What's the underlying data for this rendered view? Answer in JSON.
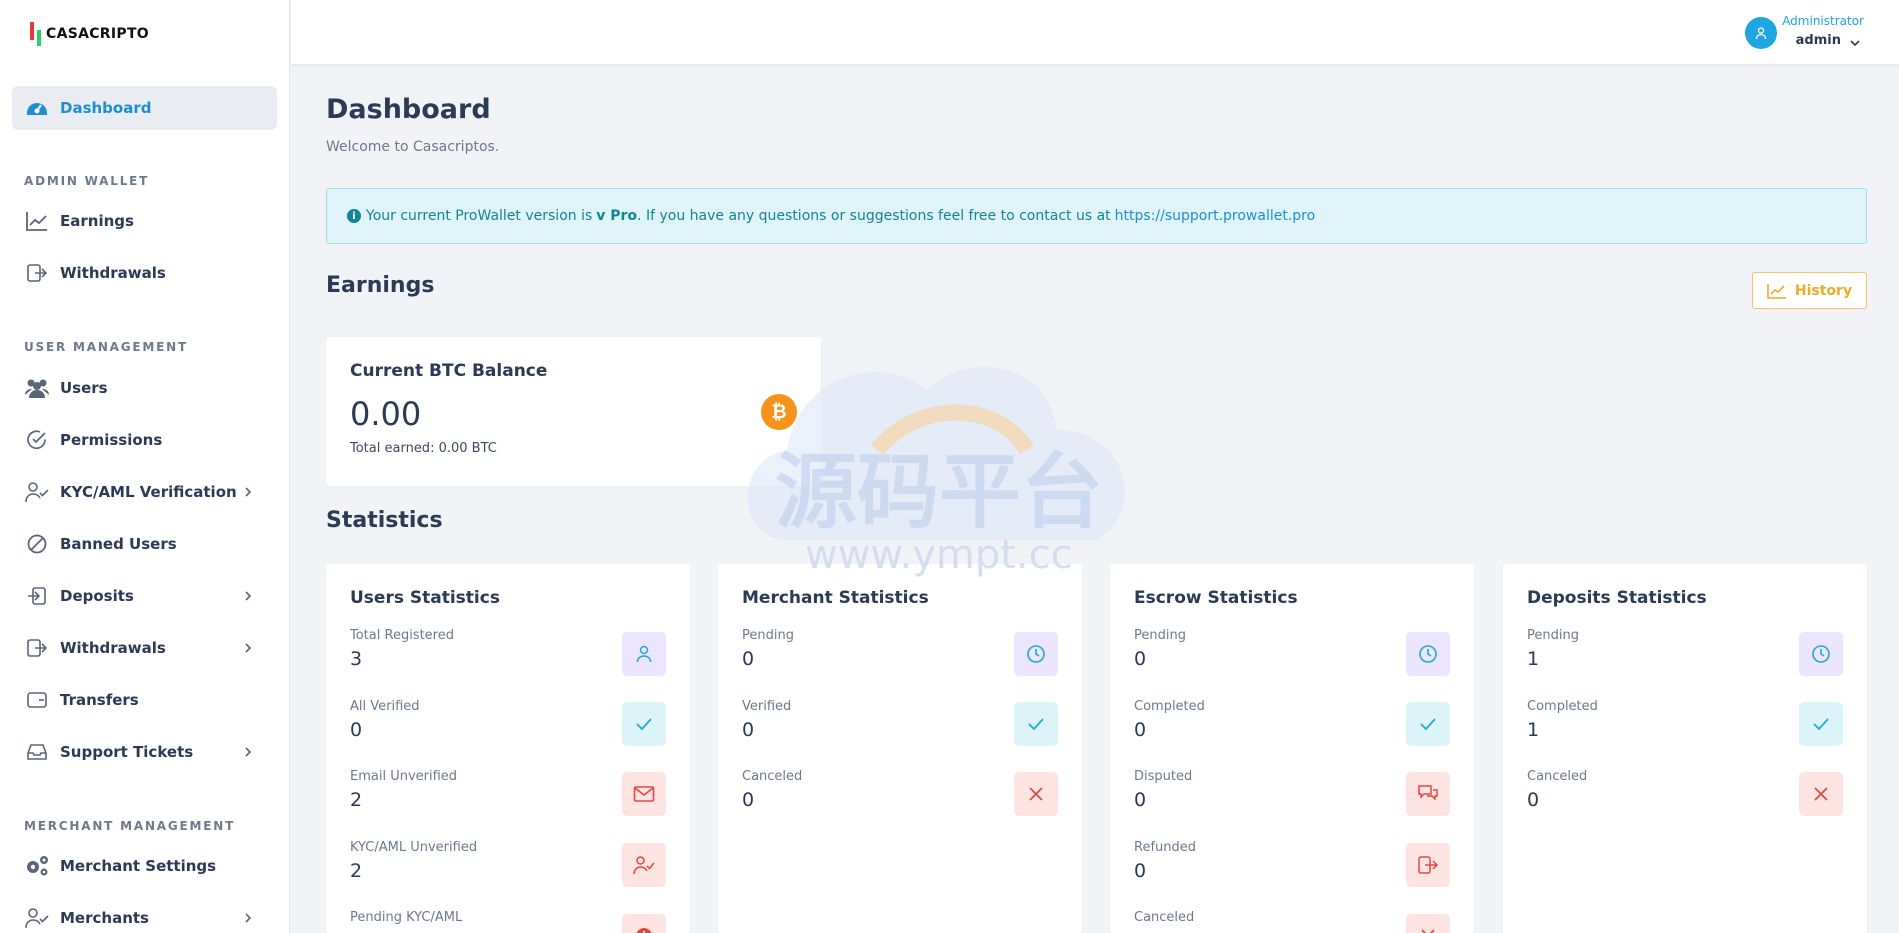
{
  "brand": {
    "name": "CASACRIPTO"
  },
  "user": {
    "role": "Administrator",
    "name": "admin"
  },
  "sidebar": {
    "dashboard": "Dashboard",
    "sections": [
      "ADMIN WALLET",
      "USER MANAGEMENT",
      "MERCHANT MANAGEMENT"
    ],
    "admin_wallet": [
      "Earnings",
      "Withdrawals"
    ],
    "user_management": [
      "Users",
      "Permissions",
      "KYC/AML Verification",
      "Banned Users",
      "Deposits",
      "Withdrawals",
      "Transfers",
      "Support Tickets"
    ],
    "merchant_management": [
      "Merchant Settings",
      "Merchants"
    ]
  },
  "page": {
    "title": "Dashboard",
    "subtitle": "Welcome to Casacriptos."
  },
  "alert": {
    "prefix": "Your current ProWallet version is",
    "version": "v Pro",
    "suffix": ". If you have any questions or suggestions feel free to contact us at",
    "link": "https://support.prowallet.pro"
  },
  "earnings": {
    "heading": "Earnings",
    "history_button": "History",
    "card_title": "Current BTC Balance",
    "balance": "0.00",
    "total_earned": "Total earned: 0.00 BTC"
  },
  "statistics": {
    "heading": "Statistics",
    "users": {
      "title": "Users Statistics",
      "items": [
        {
          "label": "Total Registered",
          "value": "3",
          "icon": "user-icon"
        },
        {
          "label": "All Verified",
          "value": "0",
          "icon": "check-icon"
        },
        {
          "label": "Email Unverified",
          "value": "2",
          "icon": "mail-icon"
        },
        {
          "label": "KYC/AML Unverified",
          "value": "2",
          "icon": "user-check-icon"
        },
        {
          "label": "Pending KYC/AML",
          "value": "",
          "icon": "alert-icon"
        }
      ]
    },
    "merchant": {
      "title": "Merchant Statistics",
      "items": [
        {
          "label": "Pending",
          "value": "0",
          "icon": "clock-icon"
        },
        {
          "label": "Verified",
          "value": "0",
          "icon": "check-icon"
        },
        {
          "label": "Canceled",
          "value": "0",
          "icon": "x-icon"
        }
      ]
    },
    "escrow": {
      "title": "Escrow Statistics",
      "items": [
        {
          "label": "Pending",
          "value": "0",
          "icon": "clock-icon"
        },
        {
          "label": "Completed",
          "value": "0",
          "icon": "check-icon"
        },
        {
          "label": "Disputed",
          "value": "0",
          "icon": "chat-icon"
        },
        {
          "label": "Refunded",
          "value": "0",
          "icon": "logout-icon"
        },
        {
          "label": "Canceled",
          "value": "",
          "icon": "x-icon"
        }
      ]
    },
    "deposits": {
      "title": "Deposits Statistics",
      "items": [
        {
          "label": "Pending",
          "value": "1",
          "icon": "clock-icon"
        },
        {
          "label": "Completed",
          "value": "1",
          "icon": "check-icon"
        },
        {
          "label": "Canceled",
          "value": "0",
          "icon": "x-icon"
        }
      ]
    }
  },
  "watermark": {
    "cn": "源码平台",
    "url": "www.ympt.cc"
  },
  "colors": {
    "accent": "#1fa6e0",
    "warning": "#f0a928",
    "danger": "#e3463f",
    "purple": "#5b8def"
  }
}
